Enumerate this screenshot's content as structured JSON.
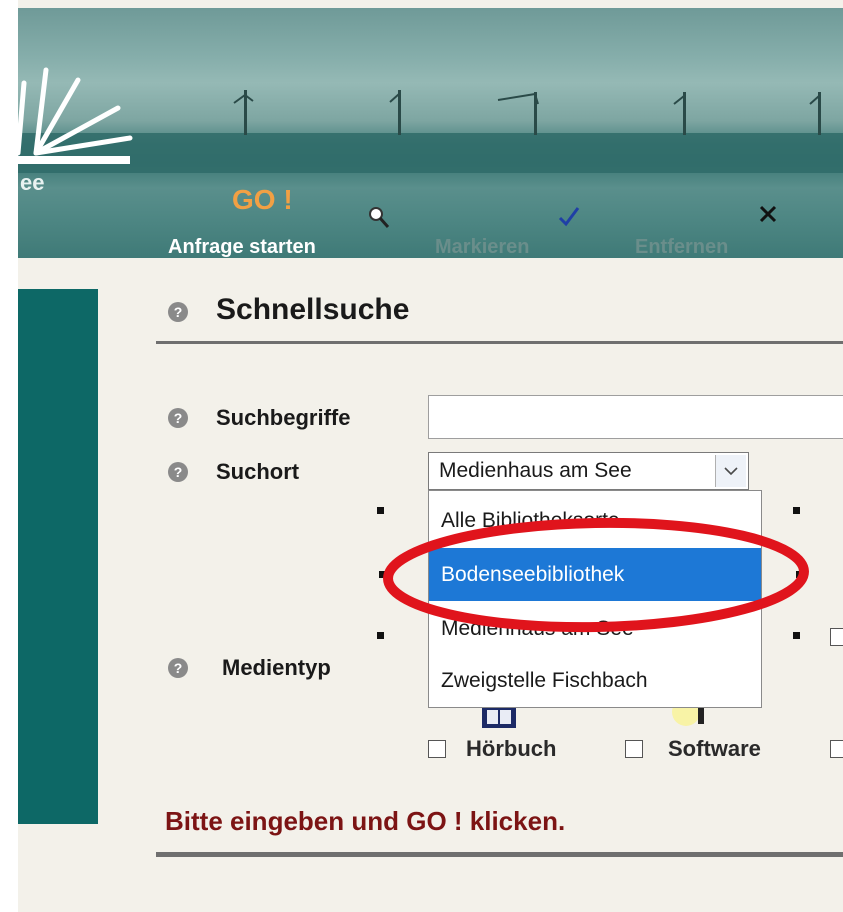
{
  "toolbar": {
    "go_label": "GO !",
    "start_label": "Anfrage starten",
    "mark_label": "Markieren",
    "remove_label": "Entfernen"
  },
  "logo": {
    "text_fragment": "ee"
  },
  "quick_search": {
    "title": "Schnellsuche",
    "search_terms_label": "Suchbegriffe",
    "search_terms_value": "",
    "location_label": "Suchort",
    "location_selected": "Medienhaus am See",
    "location_options": [
      "Alle Bibliotheksorte",
      "Bodenseebibliothek",
      "Medienhaus am See",
      "Zweigstelle Fischbach"
    ],
    "highlighted_option_index": 1,
    "media_type_label": "Medientyp",
    "media_types": [
      "Hörbuch",
      "Software"
    ],
    "message": "Bitte eingeben und GO ! klicken."
  },
  "colors": {
    "panel_teal": "#0d6866",
    "go_orange": "#f2a044",
    "message_red": "#7c1414",
    "selected_option": "#1d78d6",
    "annotation_red": "#e0141c"
  }
}
